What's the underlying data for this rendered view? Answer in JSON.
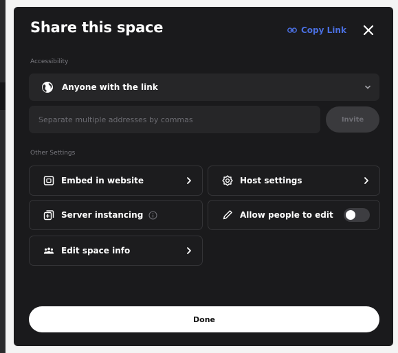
{
  "modal": {
    "title": "Share this space",
    "copy_link_label": "Copy Link"
  },
  "accessibility": {
    "section_label": "Accessibility",
    "selected": "Anyone with the link"
  },
  "invite": {
    "placeholder": "Separate multiple addresses by commas",
    "button_label": "Invite"
  },
  "other_settings": {
    "section_label": "Other Settings",
    "embed_label": "Embed in website",
    "host_label": "Host settings",
    "instancing_label": "Server instancing",
    "allow_edit_label": "Allow people to edit",
    "allow_edit_enabled": false,
    "edit_info_label": "Edit space info"
  },
  "footer": {
    "done_label": "Done"
  },
  "colors": {
    "modal_bg": "#1a1a1c",
    "accent_link": "#4a6fe0",
    "card_border": "#343437",
    "done_bg": "#ffffff"
  }
}
